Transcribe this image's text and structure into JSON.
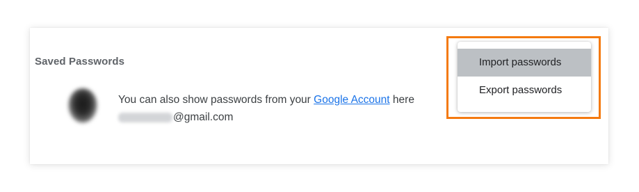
{
  "section": {
    "title": "Saved Passwords"
  },
  "info": {
    "prefix": "You can also show passwords from your ",
    "link_text": "Google Account",
    "suffix": " here",
    "email_domain": "@gmail.com"
  },
  "menu": {
    "items": [
      {
        "label": "Import passwords",
        "highlighted": true
      },
      {
        "label": "Export passwords",
        "highlighted": false
      }
    ]
  },
  "colors": {
    "highlight_border": "#f47a10",
    "link": "#1a73e8",
    "hover_item_bg": "#bcc0c4"
  }
}
